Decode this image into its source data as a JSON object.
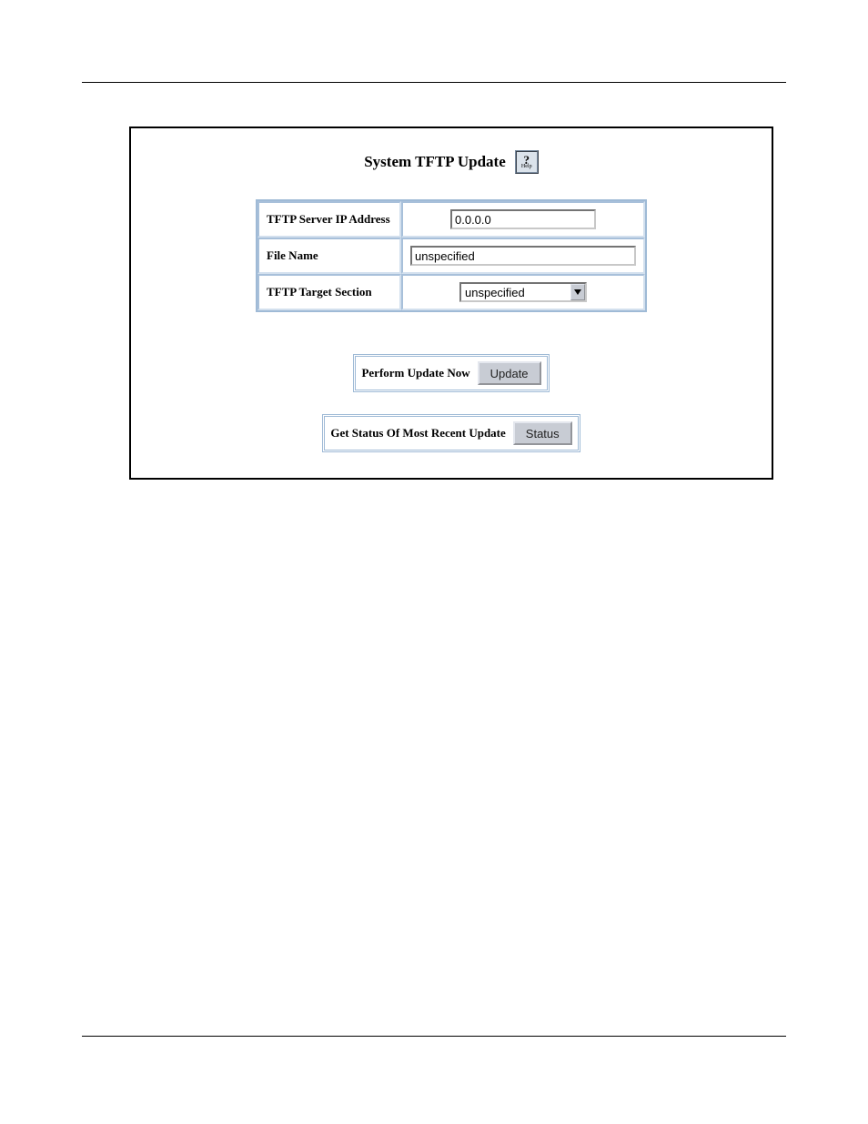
{
  "header": {
    "title": "System TFTP Update",
    "help_mark": "?",
    "help_label": "Help"
  },
  "form": {
    "rows": [
      {
        "label": "TFTP Server IP Address",
        "type": "text-center",
        "value": "0.0.0.0"
      },
      {
        "label": "File Name",
        "type": "text-full",
        "value": "unspecified"
      },
      {
        "label": "TFTP Target Section",
        "type": "select",
        "value": "unspecified"
      }
    ]
  },
  "actions": {
    "update_label": "Perform Update Now",
    "update_button": "Update",
    "status_label": "Get Status Of Most Recent Update",
    "status_button": "Status"
  }
}
